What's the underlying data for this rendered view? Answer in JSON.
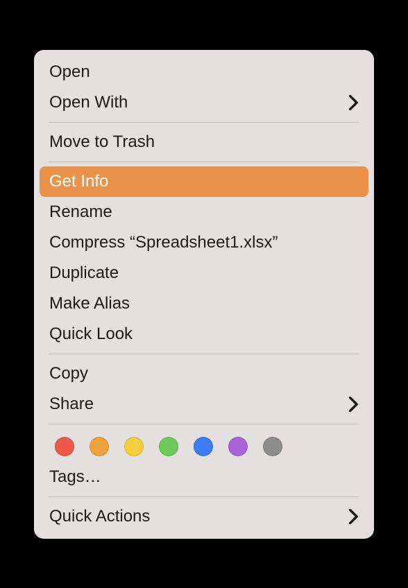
{
  "menu": {
    "open": "Open",
    "open_with": "Open With",
    "move_to_trash": "Move to Trash",
    "get_info": "Get Info",
    "rename": "Rename",
    "compress": "Compress “Spreadsheet1.xlsx”",
    "duplicate": "Duplicate",
    "make_alias": "Make Alias",
    "quick_look": "Quick Look",
    "copy": "Copy",
    "share": "Share",
    "tags": "Tags…",
    "quick_actions": "Quick Actions",
    "highlighted": "get_info"
  },
  "tag_colors": [
    "red",
    "orange",
    "yellow",
    "green",
    "blue",
    "purple",
    "gray"
  ]
}
